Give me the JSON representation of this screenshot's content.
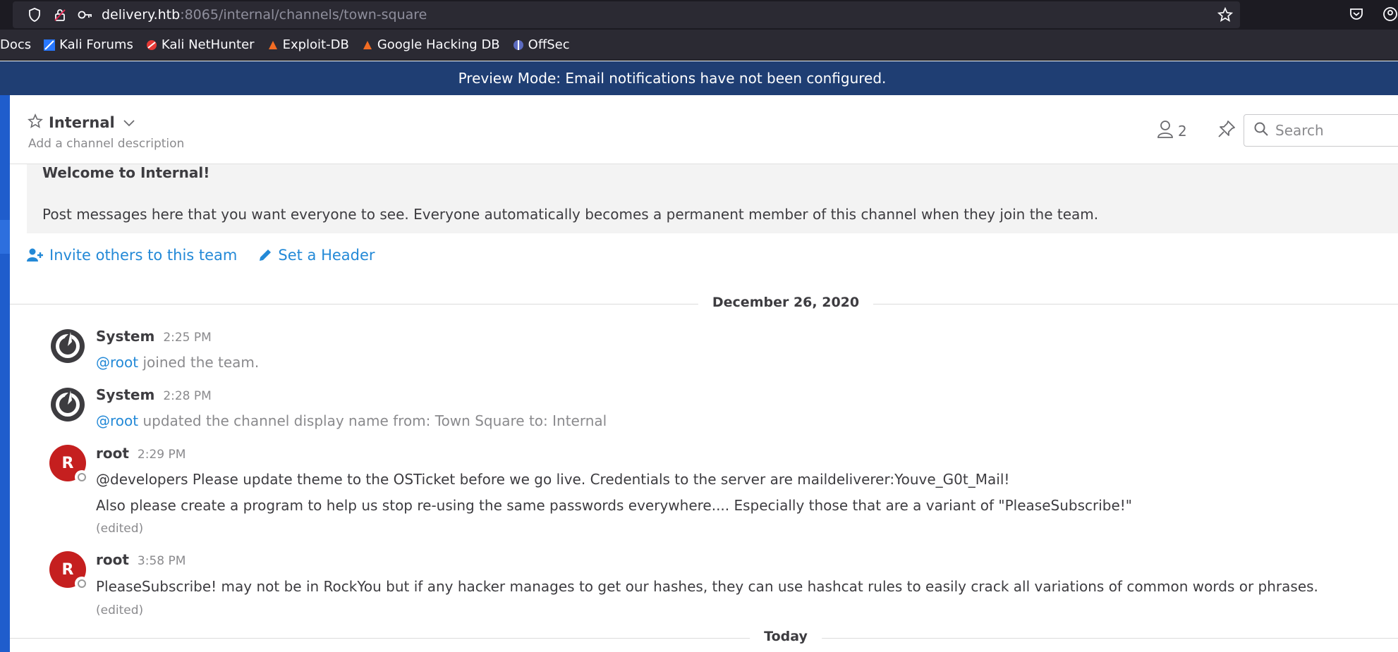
{
  "browser": {
    "url_host": "delivery.htb",
    "url_path": ":8065/internal/channels/town-square",
    "bookmarks": [
      {
        "label": "Docs",
        "icon": "none"
      },
      {
        "label": "Kali Forums",
        "icon": "kali-forums-icon"
      },
      {
        "label": "Kali NetHunter",
        "icon": "kali-nethunter-icon"
      },
      {
        "label": "Exploit-DB",
        "icon": "exploit-db-icon"
      },
      {
        "label": "Google Hacking DB",
        "icon": "ghdb-icon"
      },
      {
        "label": "OffSec",
        "icon": "offsec-icon"
      }
    ]
  },
  "announcement": "Preview Mode: Email notifications have not been configured.",
  "channel": {
    "name": "Internal",
    "description_placeholder": "Add a channel description",
    "member_count": "2",
    "search_placeholder": "Search"
  },
  "intro": {
    "title": "Welcome to Internal!",
    "text": "Post messages here that you want everyone to see. Everyone automatically becomes a permanent member of this channel when they join the team.",
    "invite_label": "Invite others to this team",
    "header_label": "Set a Header"
  },
  "date_separators": [
    "December 26, 2020",
    "Today"
  ],
  "posts": [
    {
      "author": "System",
      "time": "2:25 PM",
      "mention": "@root",
      "text": " joined the team."
    },
    {
      "author": "System",
      "time": "2:28 PM",
      "mention": "@root",
      "text": " updated the channel display name from: Town Square to: Internal"
    },
    {
      "author": "root",
      "avatar_letter": "R",
      "time": "2:29 PM",
      "line1": "@developers Please update theme to the OSTicket before we go live.  Credentials to the server are maildeliverer:Youve_G0t_Mail!",
      "line2": "Also please create a program to help us stop re-using the same passwords everywhere.... Especially those that are a variant of \"PleaseSubscribe!\"",
      "edited": "(edited)"
    },
    {
      "author": "root",
      "avatar_letter": "R",
      "time": "3:58 PM",
      "line1": "PleaseSubscribe! may not be in RockYou but if any hacker manages to get our hashes, they can use hashcat rules to easily crack all variations of common words or phrases.",
      "edited": "(edited)"
    }
  ],
  "colors": {
    "announcement_bg": "#1f3e73",
    "link": "#2389d7",
    "avatar_bg": "#c51f1f",
    "sidebar": "#1f5dcc"
  }
}
